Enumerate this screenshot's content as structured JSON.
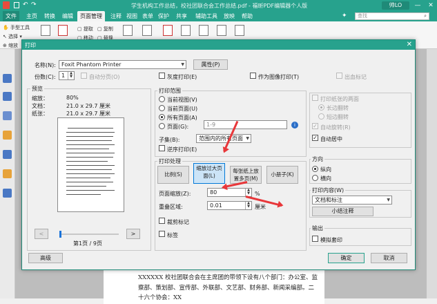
{
  "app": {
    "title": "学生机构工作总结，校社团联合会工作总结.pdf - 福昕PDF编辑器个人版",
    "user_label": "帅LO",
    "window_controls": [
      "—",
      "□",
      "✕"
    ],
    "search_placeholder": "查找",
    "brand_color": "#27a28d"
  },
  "menu": {
    "items": [
      "文件",
      "主页",
      "转换",
      "编辑",
      "页面管理",
      "注释",
      "视图",
      "表单",
      "保护",
      "共享",
      "辅助工具",
      "放映",
      "帮助"
    ],
    "active": "页面管理"
  },
  "ribbon": {
    "left_tools": [
      "手型工具",
      "选择 ▾",
      "缩放"
    ],
    "small_buttons": [
      "提取",
      "复制",
      "移动",
      "替换"
    ],
    "group_label": "工具"
  },
  "dialog": {
    "title": "打印",
    "printer": {
      "label": "名称(N):",
      "value": "Foxit Phantom Printer",
      "properties_button": "属性(P)"
    },
    "copies": {
      "label": "份数(C):",
      "value": "1",
      "collate": "自动分页(O)"
    },
    "grayscale": "灰度打印(E)",
    "as_image": "作为图像打印(T)",
    "bleed": "出血标记",
    "preview": {
      "group_title": "预览",
      "scale_label": "缩放：",
      "scale_value": "80%",
      "document_label": "文档：",
      "document_value": "21.0 x 29.7 厘米",
      "paper_label": "纸张：",
      "paper_value": "21.0 x 29.7 厘米",
      "prev_button": "<",
      "next_button": ">",
      "page_indicator": "第1页 / 9页"
    },
    "print_range": {
      "group_title": "打印范围",
      "current_view": "当前视图(V)",
      "current_page": "当前页面(U)",
      "all_pages": "所有页面(A)",
      "pages": "页面(G):",
      "pages_value": "1-9",
      "subset_label": "子集(B):",
      "subset_value": "范围内的所有页面",
      "reverse": "逆序打印(E)",
      "selected": "所有页面(A)"
    },
    "print_handling": {
      "group_title": "打印处理",
      "modes": [
        "比例(S)",
        "缩放过大页面(L)",
        "每张纸上放置多页(M)",
        "小册子(K)"
      ],
      "selected_mode": "缩放过大页面(L)",
      "zoom_label": "页面缩放(Z):",
      "zoom_value": "80",
      "zoom_unit": "%",
      "overlap_label": "重叠区域:",
      "overlap_value": "0.01",
      "overlap_unit": "厘米",
      "crop_marks": "裁剪标记",
      "labels": "标签"
    },
    "duplex": {
      "print_both_sides": "打印纸张的两面",
      "long_edge": "长边翻转",
      "short_edge": "短边翻转",
      "auto_rotate": "自动旋转(R)",
      "auto_center": "自动居中"
    },
    "orientation": {
      "group_title": "方向",
      "portrait": "纵向",
      "landscape": "横向",
      "selected": "纵向"
    },
    "print_content": {
      "group_title": "打印内容(W)",
      "value": "文档和标注",
      "summarize_button": "小结注释"
    },
    "output": {
      "group_title": "输出",
      "simulate_overprint": "模拟套印"
    },
    "advanced_button": "高级",
    "ok_button": "确定",
    "cancel_button": "取消"
  },
  "document_text": [
    "XXXXXX 校社团联合会在主席团的带领下设有八个部门：办公室、监",
    "察部、策划部、宣传部、外联部、文艺部、财务部、新闻采编部。二",
    "十六个协会：XX"
  ],
  "annotation_color": "#e8373a"
}
